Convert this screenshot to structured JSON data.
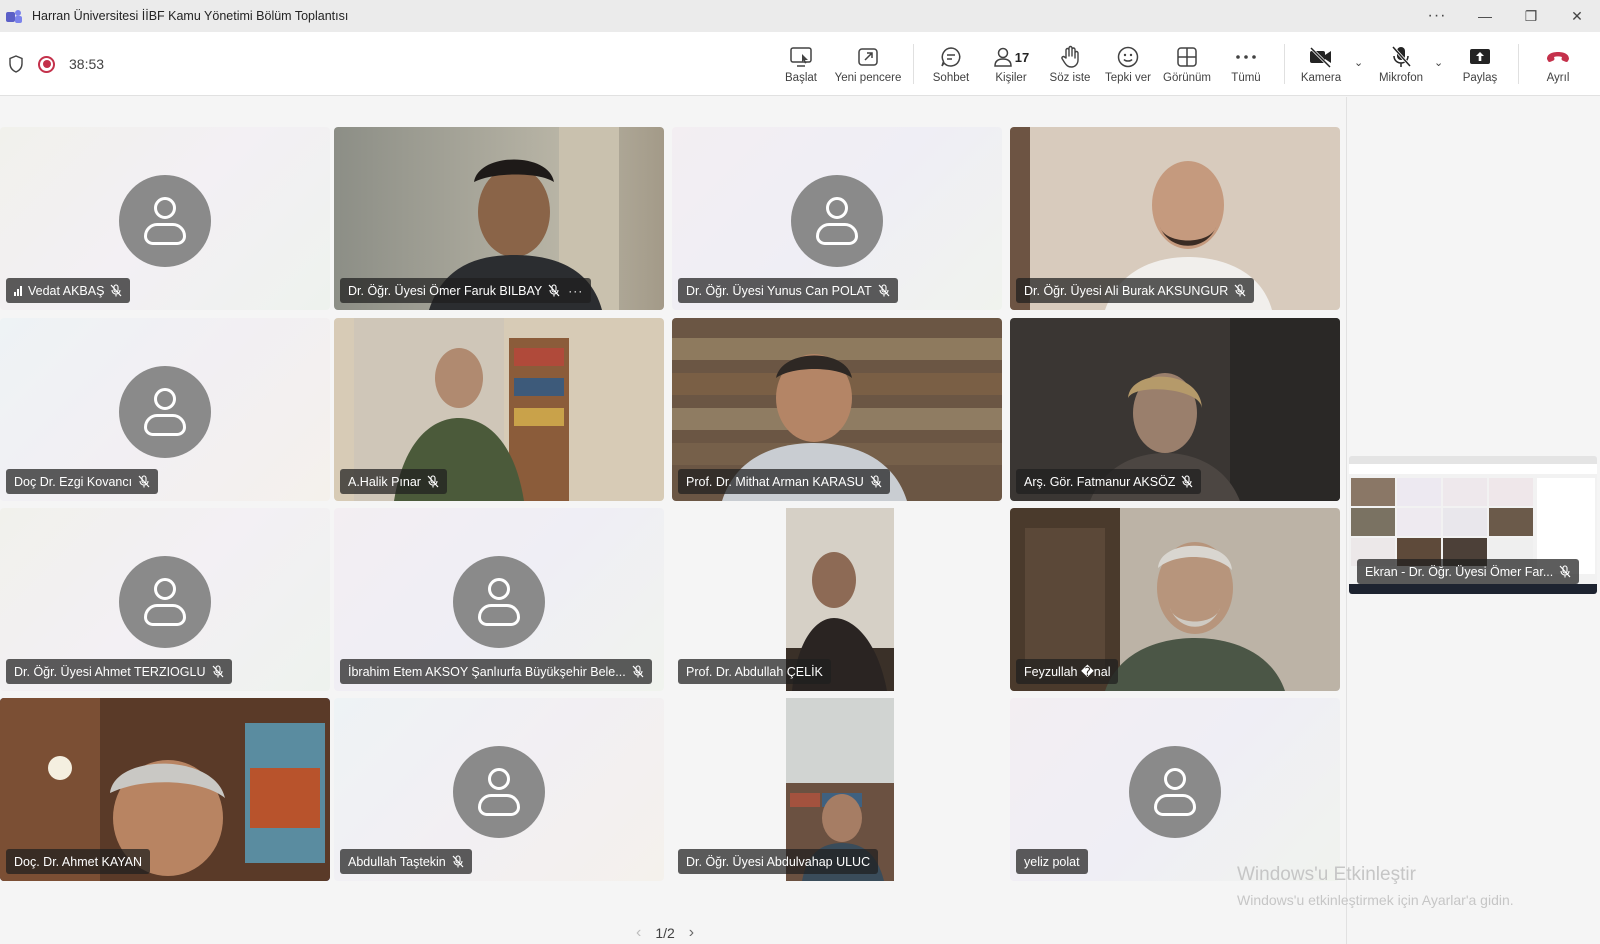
{
  "window": {
    "title": "Harran Üniversitesi İİBF Kamu Yönetimi Bölüm Toplantısı",
    "more": "···",
    "minimize": "—",
    "maximize": "❐",
    "close": "✕"
  },
  "meeting": {
    "timer": "38:53"
  },
  "toolbar": {
    "start": "Başlat",
    "new_window": "Yeni pencere",
    "chat": "Sohbet",
    "people": "Kişiler",
    "people_count": "17",
    "raise_hand": "Söz iste",
    "react": "Tepki ver",
    "view": "Görünüm",
    "more": "Tümü",
    "camera": "Kamera",
    "mic": "Mikrofon",
    "share": "Paylaş",
    "leave": "Ayrıl"
  },
  "participants": [
    {
      "name": "Vedat AKBAŞ"
    },
    {
      "name": "Dr. Öğr. Üyesi Ömer Faruk BILBAY"
    },
    {
      "name": "Dr. Öğr. Üyesi Yunus Can POLAT"
    },
    {
      "name": "Dr. Öğr. Üyesi Ali Burak AKSUNGUR"
    },
    {
      "name": "Doç Dr. Ezgi Kovancı"
    },
    {
      "name": "A.Halik Pınar"
    },
    {
      "name": "Prof. Dr. Mithat Arman KARASU"
    },
    {
      "name": "Arş. Gör. Fatmanur AKSÖZ"
    },
    {
      "name": "Dr. Öğr. Üyesi Ahmet TERZIOGLU"
    },
    {
      "name": "İbrahim Etem AKSOY Şanlıurfa Büyükşehir Bele..."
    },
    {
      "name": "Prof. Dr. Abdullah ÇELİK"
    },
    {
      "name": "Feyzullah �nal"
    },
    {
      "name": "Doç. Dr. Ahmet KAYAN"
    },
    {
      "name": "Abdullah Taştekin"
    },
    {
      "name": "Dr. Öğr. Üyesi Abdulvahap ULUC"
    },
    {
      "name": "yeliz polat"
    }
  ],
  "screen_share": {
    "label": "Ekran - Dr. Öğr. Üyesi Ömer Far..."
  },
  "pagination": {
    "current": "1/2"
  },
  "watermark": {
    "line1": "Windows'u Etkinleştir",
    "line2": "Windows'u etkinleştirmek için Ayarlar'a gidin."
  },
  "colors": {
    "accent": "#5b5fc7",
    "leave": "#c4314b",
    "record": "#c4314b"
  }
}
